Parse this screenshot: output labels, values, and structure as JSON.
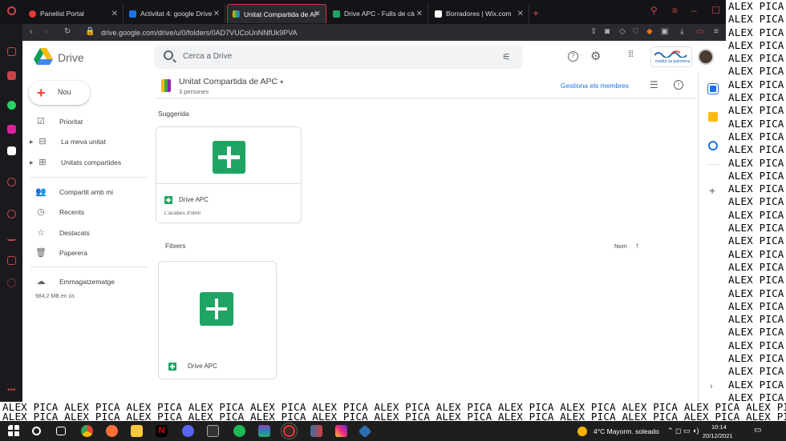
{
  "overlay_text": "ALEX PICA",
  "bottom_row": "ALEX PICA ALEX PICA ALEX PICA ALEX PICA ALEX PICA ALEX PICA ALEX PICA ALEX PICA ALEX PICA ALEX PICA ALEX PICA ALEX PICA ALEX PICA",
  "tabs": [
    {
      "label": "Panelist Portal",
      "color": "#e53935"
    },
    {
      "label": "Activitat 4: google Drive",
      "color": "#1a73e8"
    },
    {
      "label": "Unitat Compartida de APC",
      "color": "#fbbc04"
    },
    {
      "label": "Drive APC - Fulls de càlcul",
      "color": "#1fa463"
    },
    {
      "label": "Borradores | Wix.com",
      "color": "#ffffff"
    }
  ],
  "url": "drive.google.com/drive/u/0/folders/0AD7VUCoUnNNfUk9PVA",
  "app_name": "Drive",
  "search_placeholder": "Cerca a Drive",
  "school_name": "institut sa palomera",
  "new_button": "Nou",
  "nav": {
    "priority": "Prioritat",
    "my_drive": "La meva unitat",
    "shared_drives": "Unitats compartides",
    "shared_with_me": "Compartit amb mi",
    "recent": "Recents",
    "starred": "Destacats",
    "trash": "Paperera",
    "storage": "Emmagatzematge",
    "storage_used": "984,2 MB en ús"
  },
  "folder": {
    "title": "Unitat Compartida de APC",
    "members": "3 persones",
    "manage_members": "Gestiona els membres"
  },
  "suggested": {
    "heading": "Suggerida",
    "file_name": "Drive APC",
    "file_sub": "L'acabes d'obrir"
  },
  "files": {
    "heading": "Fitxers",
    "sort_label": "Nom",
    "file_name": "Drive APC"
  },
  "taskbar": {
    "weather": "4°C  Mayorm. soleado",
    "time": "10:14",
    "date": "20/12/2021"
  }
}
